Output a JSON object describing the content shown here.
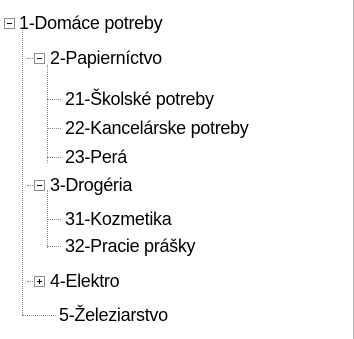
{
  "tree": {
    "nodes": [
      {
        "label": "1-Domáce potreby",
        "state": "expanded"
      },
      {
        "label": "2-Papierníctvo",
        "state": "expanded"
      },
      {
        "label": "21-Školské potreby",
        "state": "leaf"
      },
      {
        "label": "22-Kancelárske potreby",
        "state": "leaf"
      },
      {
        "label": "23-Perá",
        "state": "leaf"
      },
      {
        "label": "3-Drogéria",
        "state": "expanded"
      },
      {
        "label": "31-Kozmetika",
        "state": "leaf"
      },
      {
        "label": "32-Pracie prášky",
        "state": "leaf"
      },
      {
        "label": "4-Elektro",
        "state": "collapsed"
      },
      {
        "label": "5-Železiarstvo",
        "state": "leaf"
      }
    ]
  },
  "colors": {
    "background": "#ffffff",
    "text": "#000000",
    "connector": "#8c8c8c"
  },
  "icons": {
    "expanded": "minus-box-icon",
    "collapsed": "plus-box-icon"
  }
}
